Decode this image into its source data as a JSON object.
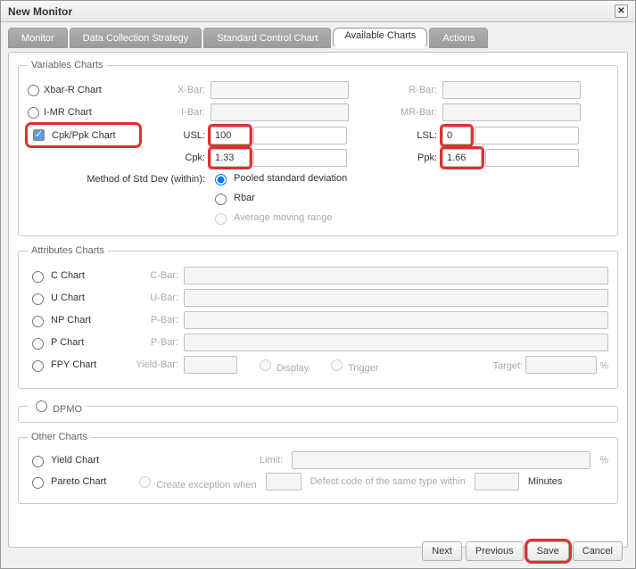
{
  "window": {
    "title": "New Monitor"
  },
  "tabs": {
    "monitor": "Monitor",
    "dcs": "Data Collection Strategy",
    "scc": "Standard Control Chart",
    "avail": "Available Charts",
    "actions": "Actions"
  },
  "variables": {
    "legend": "Variables Charts",
    "xbarr": "Xbar-R Chart",
    "xbar_lbl": "X-Bar:",
    "rbar_lbl": "R-Bar:",
    "imr": "I-MR Chart",
    "ibar_lbl": "I-Bar:",
    "mrbar_lbl": "MR-Bar:",
    "cpk": "Cpk/Ppk Chart",
    "usl_lbl": "USL:",
    "usl_val": "100",
    "lsl_lbl": "LSL:",
    "lsl_val": "0",
    "cpk_lbl": "Cpk:",
    "cpk_val": "1.33",
    "ppk_lbl": "Ppk:",
    "ppk_val": "1.66",
    "std_lbl": "Method of Std Dev (within):",
    "std_pooled": "Pooled standard deviation",
    "std_rbar": "Rbar",
    "std_amr": "Average moving range"
  },
  "attributes": {
    "legend": "Attributes Charts",
    "c": "C Chart",
    "c_lbl": "C-Bar:",
    "u": "U Chart",
    "u_lbl": "U-Bar:",
    "np": "NP Chart",
    "np_lbl": "P-Bar:",
    "p": "P Chart",
    "p_lbl": "P-Bar:",
    "fpy": "FPY Chart",
    "fpy_lbl": "Yield-Bar:",
    "display": "Display",
    "trigger": "Trigger",
    "target": "Target:",
    "pct": "%"
  },
  "dpmo": {
    "legend": "DPMO"
  },
  "other": {
    "legend": "Other Charts",
    "yield": "Yield Chart",
    "limit": "Limit:",
    "pct": "%",
    "pareto": "Pareto Chart",
    "create_exc": "Create exception when",
    "defect": "Defect code of the same type within",
    "minutes": "Minutes"
  },
  "buttons": {
    "next": "Next",
    "prev": "Previous",
    "save": "Save",
    "cancel": "Cancel"
  }
}
